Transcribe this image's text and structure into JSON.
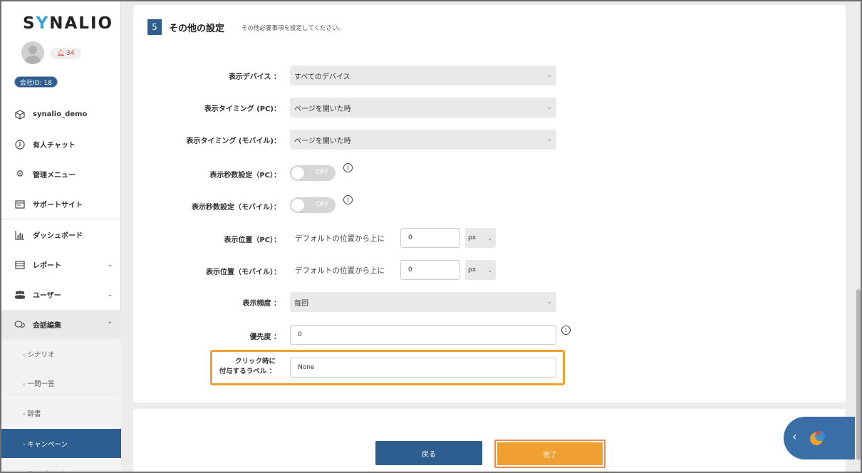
{
  "sidebar": {
    "logo": {
      "prefix": "S",
      "y": "Y",
      "suffix": "NALIO"
    },
    "notification_count": "34",
    "company_id": "会社ID: 18",
    "items": [
      {
        "label": "synalio_demo",
        "icon": "cube-icon"
      },
      {
        "label": "有人チャット",
        "icon": "headset-icon"
      },
      {
        "label": "管理メニュー",
        "icon": "gear-icon"
      },
      {
        "label": "サポートサイト",
        "icon": "window-icon"
      },
      {
        "label": "ダッシュボード",
        "icon": "bar-chart-icon"
      },
      {
        "label": "レポート",
        "icon": "report-icon"
      },
      {
        "label": "ユーザー",
        "icon": "users-icon"
      },
      {
        "label": "会話編集",
        "icon": "chat-icon"
      }
    ],
    "subitems": [
      "- シナリオ",
      "- 一問一答",
      "- 辞書",
      "- キャンペーン",
      "- テンプレート"
    ]
  },
  "section": {
    "number": "5",
    "title": "その他の設定",
    "description": "その他必要事項を設定してください。"
  },
  "form": {
    "device_label": "表示デバイス ：",
    "device_value": "すべてのデバイス",
    "timing_pc_label": "表示タイミング (PC)：",
    "timing_pc_value": "ページを開いた時",
    "timing_mobile_label": "表示タイミング (モバイル)：",
    "timing_mobile_value": "ページを開いた時",
    "seconds_pc_label": "表示秒数設定（PC）：",
    "seconds_pc_toggle": "OFF",
    "seconds_mobile_label": "表示秒数設定（モバイル）：",
    "seconds_mobile_toggle": "OFF",
    "position_pc_label": "表示位置（PC）：",
    "position_pc_text": "デフォルトの位置から上に",
    "position_pc_value": "0",
    "position_pc_unit": "px",
    "position_mobile_label": "表示位置（モバイル）：",
    "position_mobile_text": "デフォルトの位置から上に",
    "position_mobile_value": "0",
    "position_mobile_unit": "px",
    "frequency_label": "表示頻度 ：",
    "frequency_value": "毎回",
    "priority_label": "優先度 ：",
    "priority_value": "0",
    "click_label_line1": "クリック時に",
    "click_label_line2": "付与するラベル ：",
    "click_label_value": "None",
    "info_glyph": "i"
  },
  "buttons": {
    "back": "戻る",
    "done": "完了"
  },
  "colors": {
    "primary": "#2e5e8f",
    "accent": "#f0a030",
    "highlight_border": "#f0a030"
  }
}
